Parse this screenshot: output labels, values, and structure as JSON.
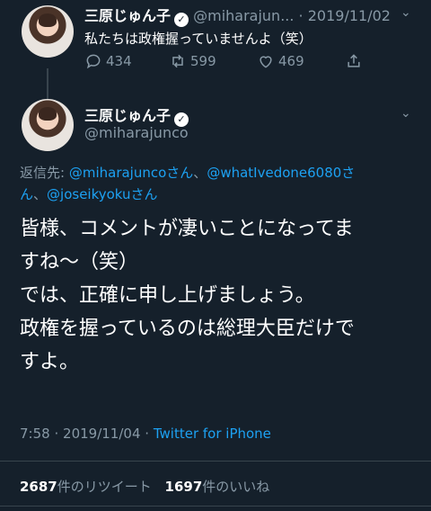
{
  "parent_tweet": {
    "name": "三原じゅん子",
    "handle": "@miharajun...",
    "separator": "·",
    "date": "2019/11/02",
    "text": "私たちは政権握っていませんよ（笑）",
    "replies": "434",
    "retweets": "599",
    "likes": "469"
  },
  "main_tweet": {
    "name": "三原じゅん子",
    "handle": "@miharajunco",
    "reply_to_label": "返信先:",
    "reply_to_user1": "@miharajuncoさん",
    "reply_sep1": "、",
    "reply_to_user2": "@whatIvedone6080さ",
    "reply_to_user2_cont": "ん",
    "reply_sep2": "、",
    "reply_to_user3": "@joseikyokuさん",
    "text_line1": "皆様、コメントが凄いことになってま",
    "text_line2": "すね〜（笑）",
    "text_line3": "では、正確に申し上げましょう。",
    "text_line4": "政権を握っているのは総理大臣だけで",
    "text_line5": "すよ。",
    "time": "7:58",
    "separator": "·",
    "date": "2019/11/04",
    "separator2": "·",
    "source": "Twitter for iPhone",
    "retweet_count": "2687",
    "retweet_label": "件のリツイート",
    "like_count": "1697",
    "like_label": "件のいいね"
  },
  "icons": {
    "reply": "reply-icon",
    "retweet": "retweet-icon",
    "like": "heart-icon",
    "share": "share-icon",
    "verified": "verified-badge-icon",
    "menu": "chevron-down-icon"
  },
  "colors": {
    "background": "#15202b",
    "link": "#1da1f2",
    "secondary_text": "#8899a6",
    "divider": "#38444d"
  }
}
